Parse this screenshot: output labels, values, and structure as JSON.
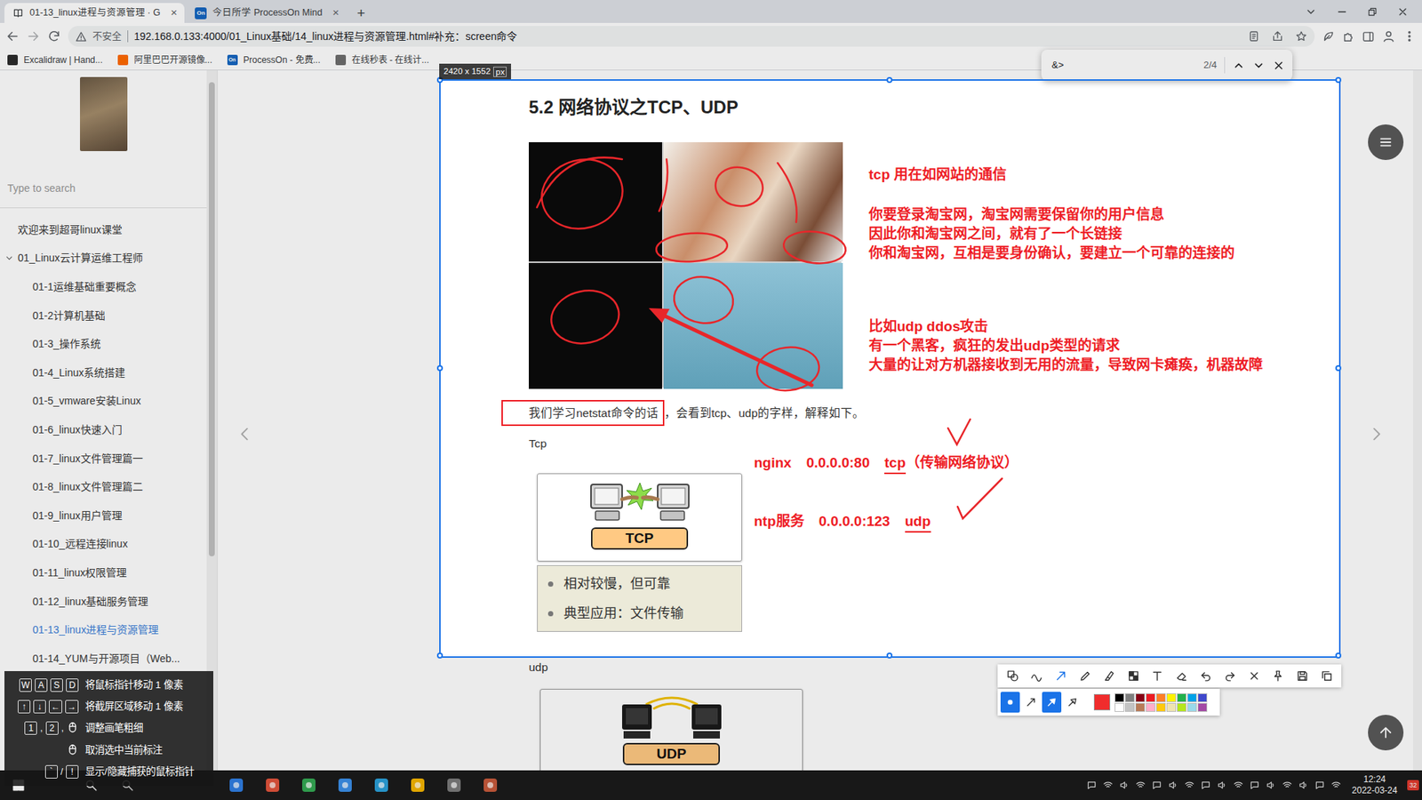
{
  "window": {
    "tabs": [
      {
        "label": "01-13_linux进程与资源管理 · G",
        "icon_text": "",
        "close": "×",
        "selected": true
      },
      {
        "label": "今日所学 ProcessOn Mind",
        "icon_text": "On",
        "close": "×",
        "selected": false
      }
    ],
    "new_tab": "+"
  },
  "toolbar": {
    "security": "不安全",
    "url": "192.168.0.133:4000/01_Linux基础/14_linux进程与资源管理.html#补充：screen命令"
  },
  "bookmarks": [
    {
      "label": "Excalidraw | Hand...",
      "icon_text": "",
      "color": "#2b2b2b"
    },
    {
      "label": "阿里巴巴开源镜像...",
      "icon_text": "",
      "color": "#ff6a00"
    },
    {
      "label": "ProcessOn - 免费...",
      "icon_text": "On",
      "color": "#1565c0"
    },
    {
      "label": "在线秒表 - 在线计...",
      "icon_text": "",
      "color": "#6d6d6d"
    }
  ],
  "find_bar": {
    "value": "&>",
    "count": "2/4"
  },
  "sidebar": {
    "search_placeholder": "Type to search",
    "items": [
      {
        "label": "欢迎来到超哥linux课堂",
        "kind": "top",
        "selected": false
      },
      {
        "label": "01_Linux云计算运维工程师",
        "kind": "group",
        "expanded": true,
        "selected": false
      },
      {
        "label": "01-1运维基础重要概念",
        "kind": "child",
        "selected": false
      },
      {
        "label": "01-2计算机基础",
        "kind": "child",
        "selected": false
      },
      {
        "label": "01-3_操作系统",
        "kind": "child",
        "selected": false
      },
      {
        "label": "01-4_Linux系统搭建",
        "kind": "child",
        "selected": false
      },
      {
        "label": "01-5_vmware安装Linux",
        "kind": "child",
        "selected": false
      },
      {
        "label": "01-6_linux快速入门",
        "kind": "child",
        "selected": false
      },
      {
        "label": "01-7_linux文件管理篇一",
        "kind": "child",
        "selected": false
      },
      {
        "label": "01-8_linux文件管理篇二",
        "kind": "child",
        "selected": false
      },
      {
        "label": "01-9_linux用户管理",
        "kind": "child",
        "selected": false
      },
      {
        "label": "01-10_远程连接linux",
        "kind": "child",
        "selected": false
      },
      {
        "label": "01-11_linux权限管理",
        "kind": "child",
        "selected": false
      },
      {
        "label": "01-12_linux基础服务管理",
        "kind": "child",
        "selected": false
      },
      {
        "label": "01-13_linux进程与资源管理",
        "kind": "child",
        "selected": true
      },
      {
        "label": "01-14_YUM与开源项目（Web...",
        "kind": "child",
        "selected": false
      }
    ]
  },
  "article": {
    "heading": "5.2 网络协议之TCP、UDP",
    "notes": [
      {
        "lines": [
          "tcp 用在如网站的通信"
        ]
      },
      {
        "lines": [
          "你要登录淘宝网，淘宝网需要保留你的用户信息",
          "因此你和淘宝网之间，就有了一个长链接",
          "你和淘宝网，互相是要身份确认，要建立一个可靠的连接的"
        ]
      },
      {
        "lines": [
          "比如udp ddos攻击",
          "有一个黑客，疯狂的发出udp类型的请求",
          "大量的让对方机器接收到无用的流量，导致网卡瘫痪，机器故障"
        ]
      }
    ],
    "sentence_boxed": "我们学习netstat命令的话",
    "sentence_rest": "，会看到tcp、udp的字样，解释如下。",
    "tcp_label": "Tcp",
    "tcp_figure": {
      "title": "TCP",
      "bullets": [
        "相对较慢，但可靠",
        "典型应用：文件传输"
      ]
    },
    "ports": [
      {
        "service": "nginx",
        "address": "0.0.0.0:80",
        "protocol": "tcp",
        "note": "（传输网络协议）"
      },
      {
        "service": "ntp服务",
        "address": "0.0.0.0:123",
        "protocol": "udp",
        "note": ""
      }
    ],
    "udp_label": "udp",
    "udp_figure": {
      "title": "UDP"
    }
  },
  "capture": {
    "size": "2420 x 1552",
    "unit": "px",
    "tools": [
      {
        "kind": "shape",
        "selected": false
      },
      {
        "kind": "curve",
        "selected": false
      },
      {
        "kind": "arrow",
        "selected": true
      },
      {
        "kind": "pen",
        "selected": false
      },
      {
        "kind": "marker",
        "selected": false
      },
      {
        "kind": "mosaic",
        "selected": false
      },
      {
        "kind": "text",
        "selected": false
      },
      {
        "kind": "eraser",
        "selected": false
      },
      {
        "kind": "undo",
        "selected": false
      },
      {
        "kind": "redo",
        "selected": false
      },
      {
        "kind": "close",
        "selected": false
      },
      {
        "kind": "pin",
        "selected": false
      },
      {
        "kind": "save",
        "selected": false
      },
      {
        "kind": "copy",
        "selected": false
      }
    ],
    "options": [
      {
        "kind": "dot",
        "selected": true
      },
      {
        "kind": "arrow-thin",
        "selected": false
      },
      {
        "kind": "arrow-fill",
        "selected": true
      },
      {
        "kind": "arrow-outline",
        "selected": false
      }
    ],
    "current_color": "#f02c2c",
    "palette": [
      {
        "color": "#000000",
        "selected": false
      },
      {
        "color": "#7f7f7f",
        "selected": false
      },
      {
        "color": "#880015",
        "selected": false
      },
      {
        "color": "#ed1c24",
        "selected": false
      },
      {
        "color": "#ff7f27",
        "selected": false
      },
      {
        "color": "#fff200",
        "selected": false
      },
      {
        "color": "#22b14c",
        "selected": false
      },
      {
        "color": "#00a2e8",
        "selected": false
      },
      {
        "color": "#3f48cc",
        "selected": false
      },
      {
        "color": "#ffffff",
        "selected": false
      },
      {
        "color": "#c3c3c3",
        "selected": false
      },
      {
        "color": "#b97a57",
        "selected": false
      },
      {
        "color": "#ffaec9",
        "selected": false
      },
      {
        "color": "#ffc90e",
        "selected": false
      },
      {
        "color": "#efe4b0",
        "selected": false
      },
      {
        "color": "#b5e61d",
        "selected": false
      },
      {
        "color": "#99d9ea",
        "selected": false
      },
      {
        "color": "#a349a4",
        "selected": false
      }
    ]
  },
  "hints": [
    {
      "keys": [
        {
          "kind": "key",
          "text": "W"
        },
        {
          "kind": "key",
          "text": "A"
        },
        {
          "kind": "key",
          "text": "S"
        },
        {
          "kind": "key",
          "text": "D"
        }
      ],
      "text": "将鼠标指针移动 1 像素"
    },
    {
      "keys": [
        {
          "kind": "key",
          "text": "↑"
        },
        {
          "kind": "key",
          "text": "↓"
        },
        {
          "kind": "key",
          "text": "←"
        },
        {
          "kind": "key",
          "text": "→"
        }
      ],
      "text": "将截屏区域移动 1 像素"
    },
    {
      "keys": [
        {
          "kind": "key",
          "text": "1"
        },
        {
          "kind": "sep",
          "text": ","
        },
        {
          "kind": "key",
          "text": "2"
        },
        {
          "kind": "sep",
          "text": ","
        },
        {
          "kind": "mouse"
        }
      ],
      "text": "调整画笔粗细"
    },
    {
      "keys": [
        {
          "kind": "mouse"
        }
      ],
      "text": "取消选中当前标注"
    },
    {
      "keys": [
        {
          "kind": "key",
          "text": "`"
        },
        {
          "kind": "sep",
          "text": "/"
        },
        {
          "kind": "key",
          "text": "!"
        }
      ],
      "text": "显示/隐藏捕获的鼠标指针"
    }
  ],
  "taskbar": {
    "time": "12:24",
    "date": "2022-03-24",
    "badge": "32"
  }
}
